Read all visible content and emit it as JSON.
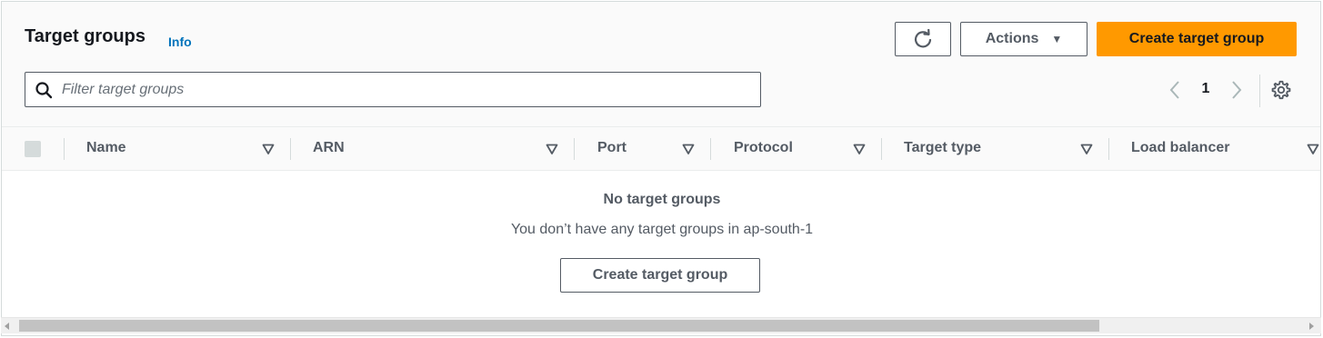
{
  "header": {
    "title": "Target groups",
    "info_label": "Info",
    "refresh_icon": "refresh-icon",
    "actions_label": "Actions",
    "actions_caret": "▼",
    "create_label": "Create target group"
  },
  "search": {
    "placeholder": "Filter target groups",
    "value": ""
  },
  "pagination": {
    "current_page": "1",
    "prev_icon": "chevron-left-icon",
    "next_icon": "chevron-right-icon",
    "settings_icon": "gear-icon"
  },
  "table": {
    "columns": [
      "Name",
      "ARN",
      "Port",
      "Protocol",
      "Target type",
      "Load balancer"
    ],
    "rows": []
  },
  "empty": {
    "title": "No target groups",
    "description": "You don’t have any target groups in ap-south-1",
    "button_label": "Create target group"
  },
  "colors": {
    "primary": "#ff9900",
    "link": "#0073bb",
    "text": "#16191f",
    "muted": "#545b64"
  }
}
